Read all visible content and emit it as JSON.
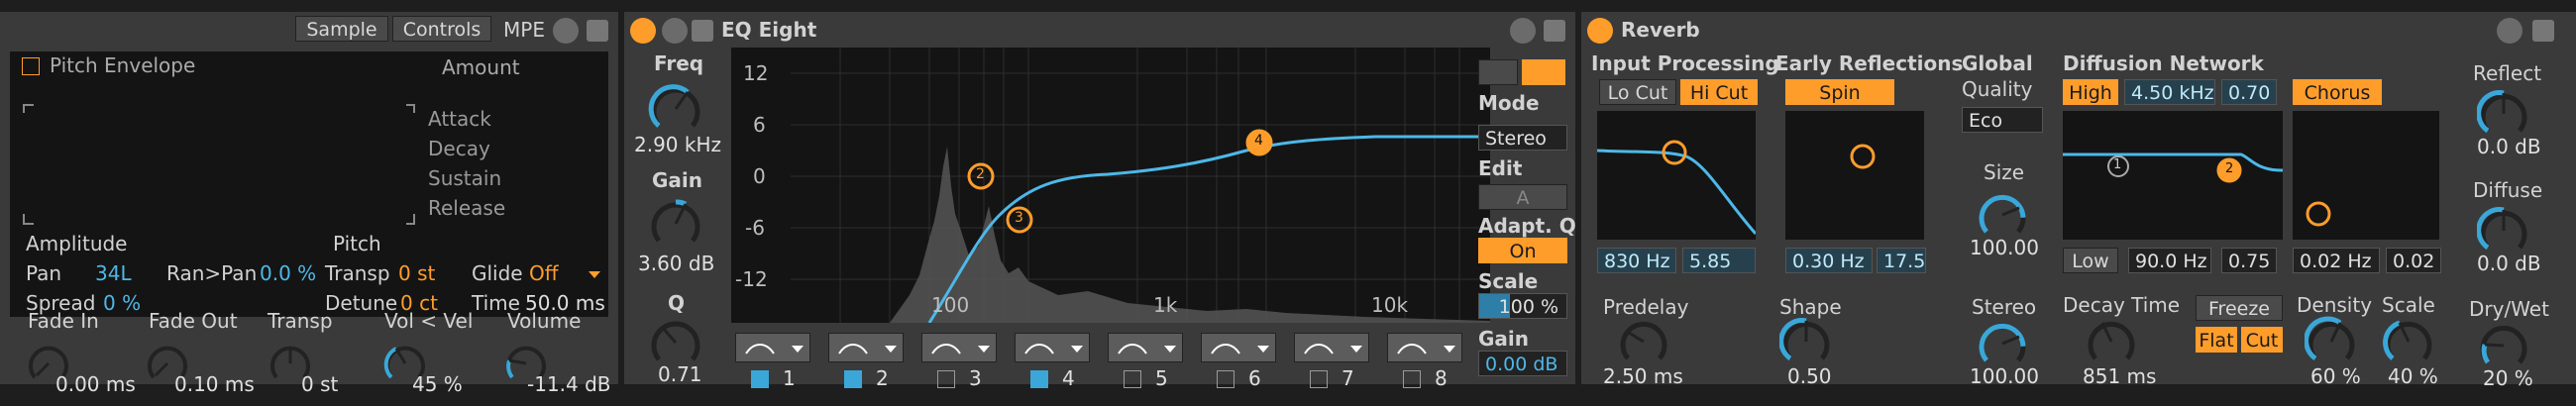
{
  "sampler": {
    "tabs": [
      "Sample",
      "Controls",
      "MPE"
    ],
    "pitch_envelope": {
      "title": "Pitch Envelope",
      "amount_label": "Amount",
      "stages": [
        "Attack",
        "Decay",
        "Sustain",
        "Release"
      ]
    },
    "amplitude": {
      "title": "Amplitude",
      "pan_label": "Pan",
      "pan_value": "34L",
      "ranpan_label": "Ran>Pan",
      "ranpan_value": "0.0 %",
      "spread_label": "Spread",
      "spread_value": "0 %"
    },
    "pitch": {
      "title": "Pitch",
      "transp_label": "Transp",
      "transp_value": "0 st",
      "detune_label": "Detune",
      "detune_value": "0 ct",
      "glide_label": "Glide",
      "glide_value": "Off",
      "time_label": "Time",
      "time_value": "50.0 ms"
    },
    "bottom": {
      "fade_in_label": "Fade In",
      "fade_in_value": "0.00 ms",
      "fade_out_label": "Fade Out",
      "fade_out_value": "0.10 ms",
      "transp_label": "Transp",
      "transp_value": "0 st",
      "volvel_label": "Vol < Vel",
      "volvel_value": "45 %",
      "volume_label": "Volume",
      "volume_value": "-11.4 dB"
    }
  },
  "eq": {
    "title": "EQ Eight",
    "freq_label": "Freq",
    "freq_value": "2.90 kHz",
    "gain_label": "Gain",
    "gain_value": "3.60 dB",
    "q_label": "Q",
    "q_value": "0.71",
    "y_ticks": [
      "12",
      "6",
      "0",
      "-6",
      "-12"
    ],
    "x_ticks": [
      "100",
      "1k",
      "10k"
    ],
    "band_markers": [
      "2",
      "3",
      "4"
    ],
    "mode_label": "Mode",
    "mode_value": "Stereo",
    "edit_label": "Edit",
    "edit_value": "A",
    "adaptq_label": "Adapt. Q",
    "adaptq_value": "On",
    "scale_label": "Scale",
    "scale_value": "100 %",
    "gain2_label": "Gain",
    "gain2_value": "0.00 dB",
    "bands": [
      "1",
      "2",
      "3",
      "4",
      "5",
      "6",
      "7",
      "8"
    ],
    "band_enabled": [
      true,
      true,
      false,
      true,
      false,
      false,
      false,
      false
    ]
  },
  "reverb": {
    "title": "Reverb",
    "input_processing": {
      "title": "Input Processing",
      "locut": "Lo Cut",
      "hicut": "Hi Cut",
      "freq": "830 Hz",
      "q": "5.85"
    },
    "early_reflections": {
      "title": "Early Reflections",
      "spin": "Spin",
      "freq": "0.30 Hz",
      "amount": "17.5"
    },
    "global": {
      "title": "Global",
      "quality_label": "Quality",
      "quality_value": "Eco",
      "size_label": "Size",
      "size_value": "100.00",
      "stereo_label": "Stereo",
      "stereo_value": "100.00"
    },
    "diffusion": {
      "title": "Diffusion Network",
      "high": "High",
      "high_freq": "4.50 kHz",
      "high_amount": "0.70",
      "chorus": "Chorus",
      "low": "Low",
      "low_freq": "90.0 Hz",
      "low_amount": "0.75",
      "chorus_freq": "0.02 Hz",
      "chorus_amount": "0.02",
      "markers": [
        "1",
        "2"
      ]
    },
    "predelay_label": "Predelay",
    "predelay_value": "2.50 ms",
    "shape_label": "Shape",
    "shape_value": "0.50",
    "decay_label": "Decay Time",
    "decay_value": "851 ms",
    "freeze": "Freeze",
    "flat": "Flat",
    "cut": "Cut",
    "density_label": "Density",
    "density_value": "60 %",
    "scale_label": "Scale",
    "scale_value": "40 %",
    "reflect_label": "Reflect",
    "reflect_value": "0.0 dB",
    "diffuse_label": "Diffuse",
    "diffuse_value": "0.0 dB",
    "drywet_label": "Dry/Wet",
    "drywet_value": "20 %"
  },
  "colors": {
    "accent": "#ff9d2b",
    "blue": "#4db8e8",
    "panel": "#3a3a3a",
    "display": "#141414"
  }
}
